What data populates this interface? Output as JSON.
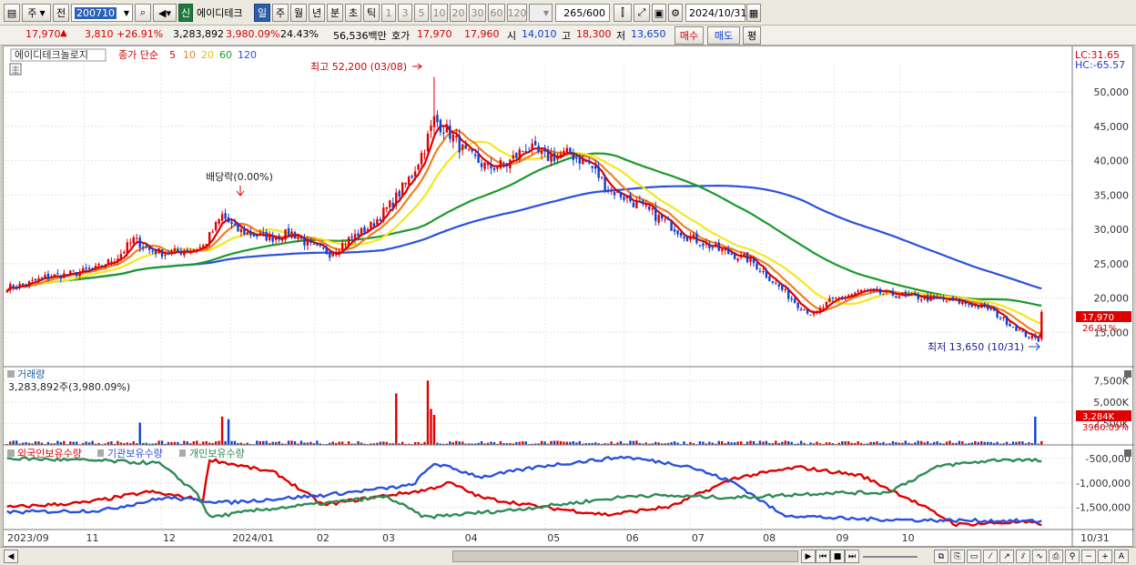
{
  "toolbar": {
    "market": "주",
    "scope": "전",
    "code": "200710",
    "sin_badge": "신",
    "name": "에이디테크",
    "periods": [
      "일",
      "주",
      "월",
      "년",
      "분",
      "초",
      "틱"
    ],
    "active_period": "일",
    "minutes": [
      "1",
      "3",
      "5",
      "10",
      "20",
      "30",
      "60",
      "120"
    ],
    "count": "265",
    "count_total": "/600",
    "date": "2024/10/31"
  },
  "quote": {
    "price": "17,970",
    "change_arrow": "▲",
    "change": "3,810",
    "change_pct": "+26.91%",
    "volume": "3,283,892",
    "volume_pct": "3,980.09%",
    "turnover": "24.43%",
    "amount": "56,536백만",
    "hoga_label": "호가",
    "ask": "17,970",
    "bid": "17,960",
    "open_label": "시",
    "open": "14,010",
    "high_label": "고",
    "high": "18,300",
    "low_label": "저",
    "low": "13,650",
    "buy_btn": "매수",
    "sell_btn": "매도",
    "eval_btn": "평"
  },
  "price_panel": {
    "legend_name": "에이디테크놀로지",
    "legend_type": "종가 단순",
    "ma_periods": [
      "5",
      "10",
      "20",
      "60",
      "120"
    ],
    "lc": "LC:31.65",
    "hc": "HC:-65.57",
    "high_note": "최고 52,200 (03/08)",
    "low_note": "최저 13,650 (10/31)",
    "dividend_note": "배당락(0.00%)",
    "current_price_tag": "17,970",
    "current_pct_tag": "26.91%"
  },
  "volume_panel": {
    "title": "거래량",
    "summary": "3,283,892주(3,980.09%)",
    "current_tag": "3,284K",
    "current_pct": "3980.09%"
  },
  "holder_panel": {
    "series": [
      "외국인보유수량",
      "기관보유수량",
      "개인보유수량"
    ]
  },
  "x_labels": [
    "2023/09",
    "11",
    "12",
    "2024/01",
    "02",
    "03",
    "04",
    "05",
    "06",
    "07",
    "08",
    "09",
    "10",
    "10/31"
  ],
  "colors": {
    "up": "#e00000",
    "down": "#1040d0",
    "ma5": "#e00000",
    "ma10": "#f08020",
    "ma20": "#f5e81a",
    "ma60": "#1a9a2a",
    "ma120": "#2a50e0",
    "foreign": "#e00000",
    "institution": "#2a50e0",
    "individual": "#2e8b57"
  },
  "chart_data": {
    "type": "candlestick",
    "price_axis": {
      "ticks": [
        15000,
        20000,
        25000,
        30000,
        35000,
        40000,
        45000,
        50000
      ],
      "tick_labels": [
        "15,000",
        "20,000",
        "25,000",
        "30,000",
        "35,000",
        "40,000",
        "45,000",
        "50,000"
      ],
      "ylim": [
        10000,
        54000
      ]
    },
    "volume_axis": {
      "ticks": [
        2500000,
        5000000,
        7500000
      ],
      "tick_labels": [
        "2,500K",
        "5,000K",
        "7,500K"
      ],
      "ylim": [
        0,
        8800000
      ]
    },
    "holder_axis": {
      "ticks": [
        -500000,
        -1000000,
        -1500000
      ],
      "tick_labels": [
        "-500,000",
        "-1,000,000",
        "-1,500,000"
      ],
      "ylim": [
        -1950000,
        -300000
      ]
    },
    "close_knots": [
      [
        0,
        21500
      ],
      [
        6,
        22000
      ],
      [
        12,
        23000
      ],
      [
        20,
        23500
      ],
      [
        28,
        24200
      ],
      [
        35,
        26000
      ],
      [
        40,
        28500
      ],
      [
        45,
        27000
      ],
      [
        50,
        26500
      ],
      [
        55,
        26800
      ],
      [
        62,
        27500
      ],
      [
        68,
        32000
      ],
      [
        72,
        30000
      ],
      [
        78,
        29200
      ],
      [
        84,
        28800
      ],
      [
        90,
        29500
      ],
      [
        96,
        27500
      ],
      [
        102,
        26500
      ],
      [
        108,
        28500
      ],
      [
        115,
        30500
      ],
      [
        122,
        34000
      ],
      [
        128,
        38000
      ],
      [
        132,
        42000
      ],
      [
        135,
        46000
      ],
      [
        140,
        44000
      ],
      [
        145,
        41000
      ],
      [
        152,
        39000
      ],
      [
        158,
        39500
      ],
      [
        164,
        42000
      ],
      [
        170,
        40500
      ],
      [
        178,
        41000
      ],
      [
        184,
        39500
      ],
      [
        190,
        36000
      ],
      [
        196,
        34500
      ],
      [
        205,
        32000
      ],
      [
        215,
        29000
      ],
      [
        225,
        27000
      ],
      [
        235,
        25500
      ],
      [
        242,
        22500
      ],
      [
        250,
        19000
      ],
      [
        255,
        17500
      ],
      [
        260,
        19500
      ],
      [
        270,
        21000
      ],
      [
        280,
        20500
      ],
      [
        290,
        20000
      ],
      [
        300,
        19500
      ],
      [
        310,
        18500
      ],
      [
        316,
        16500
      ],
      [
        322,
        14600
      ],
      [
        326,
        13900
      ],
      [
        327,
        17970
      ]
    ],
    "ma_final": {
      "ma5": 14900,
      "ma10": 15500,
      "ma20": 16800,
      "ma60": 18900,
      "ma120": 24300
    },
    "volume_spikes": [
      [
        42,
        2600000
      ],
      [
        68,
        3300000
      ],
      [
        70,
        3000000
      ],
      [
        123,
        6000000
      ],
      [
        133,
        7500000
      ],
      [
        134,
        4200000
      ],
      [
        135,
        3500000
      ],
      [
        325,
        3284000
      ]
    ],
    "holders": {
      "foreign": [
        [
          0,
          -1500000
        ],
        [
          25,
          -1400000
        ],
        [
          45,
          -1180000
        ],
        [
          62,
          -1350000
        ],
        [
          64,
          -520000
        ],
        [
          85,
          -800000
        ],
        [
          100,
          -1450000
        ],
        [
          115,
          -1300000
        ],
        [
          132,
          -1150000
        ],
        [
          140,
          -1000000
        ],
        [
          150,
          -1300000
        ],
        [
          170,
          -1500000
        ],
        [
          190,
          -1650000
        ],
        [
          210,
          -1480000
        ],
        [
          230,
          -900000
        ],
        [
          250,
          -680000
        ],
        [
          270,
          -850000
        ],
        [
          285,
          -1320000
        ],
        [
          300,
          -1850000
        ],
        [
          320,
          -1800000
        ],
        [
          327,
          -1830000
        ]
      ],
      "institution": [
        [
          0,
          -1600000
        ],
        [
          30,
          -1560000
        ],
        [
          50,
          -1300000
        ],
        [
          70,
          -1400000
        ],
        [
          100,
          -1250000
        ],
        [
          128,
          -1050000
        ],
        [
          135,
          -600000
        ],
        [
          150,
          -880000
        ],
        [
          170,
          -650000
        ],
        [
          195,
          -470000
        ],
        [
          215,
          -650000
        ],
        [
          230,
          -1000000
        ],
        [
          245,
          -1650000
        ],
        [
          265,
          -1730000
        ],
        [
          290,
          -1760000
        ],
        [
          327,
          -1780000
        ]
      ],
      "individual": [
        [
          0,
          -500000
        ],
        [
          30,
          -550000
        ],
        [
          48,
          -600000
        ],
        [
          60,
          -1200000
        ],
        [
          64,
          -1700000
        ],
        [
          80,
          -1550000
        ],
        [
          120,
          -1280000
        ],
        [
          132,
          -1700000
        ],
        [
          160,
          -1550000
        ],
        [
          200,
          -1250000
        ],
        [
          230,
          -1300000
        ],
        [
          260,
          -1200000
        ],
        [
          278,
          -1200000
        ],
        [
          295,
          -650000
        ],
        [
          315,
          -520000
        ],
        [
          327,
          -550000
        ]
      ]
    }
  }
}
